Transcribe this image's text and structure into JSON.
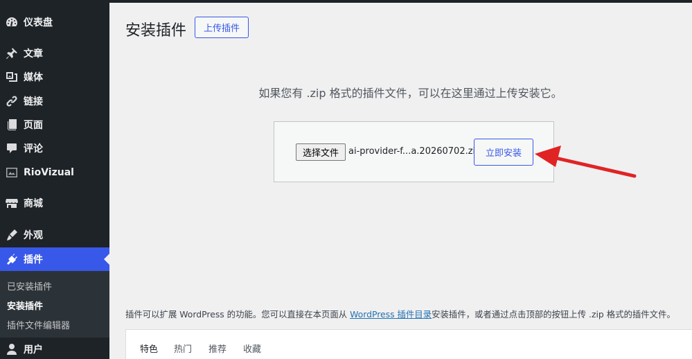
{
  "sidebar": {
    "items": [
      {
        "label": "仪表盘",
        "icon": "dashboard-icon"
      },
      {
        "label": "文章",
        "icon": "pin-icon"
      },
      {
        "label": "媒体",
        "icon": "media-icon"
      },
      {
        "label": "链接",
        "icon": "link-icon"
      },
      {
        "label": "页面",
        "icon": "page-icon"
      },
      {
        "label": "评论",
        "icon": "comment-icon"
      },
      {
        "label": "RioVizual",
        "icon": "riovizual-icon"
      },
      {
        "label": "商城",
        "icon": "store-icon"
      },
      {
        "label": "外观",
        "icon": "appearance-icon"
      },
      {
        "label": "插件",
        "icon": "plugin-icon"
      },
      {
        "label": "用户",
        "icon": "user-icon"
      }
    ],
    "active": "插件",
    "submenu": [
      "已安装插件",
      "安装插件",
      "插件文件编辑器"
    ],
    "submenu_current": "安装插件"
  },
  "header": {
    "title": "安装插件",
    "upload_button": "上传插件"
  },
  "upload": {
    "help_text": "如果您有 .zip 格式的插件文件，可以在这里通过上传安装它。",
    "choose_file_button": "选择文件",
    "file_name": "ai-provider-f...a.20260702.zip",
    "install_button": "立即安装"
  },
  "footer": {
    "text_before": "插件可以扩展 WordPress 的功能。您可以直接在本页面从 ",
    "link_text": "WordPress 插件目录",
    "text_after": "安装插件，或者通过点击顶部的按钮上传 .zip 格式的插件文件。"
  },
  "filters": [
    "特色",
    "热门",
    "推荐",
    "收藏"
  ],
  "colors": {
    "sidebar_bg": "#1d2327",
    "accent": "#3858e9",
    "arrow": "#e02424"
  }
}
